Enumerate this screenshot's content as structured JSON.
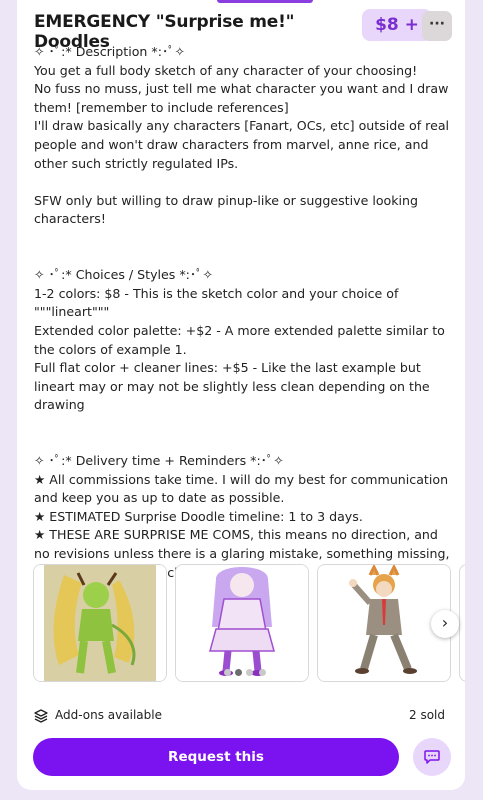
{
  "listing": {
    "title": "EMERGENCY \"Surprise me!\" Doodles",
    "price": "$8 +",
    "more_icon": "ellipsis-icon",
    "more_label": "···"
  },
  "description": {
    "text": "✧ ･ﾟ:* Description *:･ﾟ✧\nYou get a full body sketch of any character of your choosing!\nNo fuss no muss, just tell me what character you want and I draw them! [remember to include references]\nI'll draw basically any characters [Fanart, OCs, etc] outside of real people and won't draw characters from marvel, anne rice, and other such strictly regulated IPs.\n\nSFW only but willing to draw pinup-like or suggestive looking characters!\n\n\n✧ ･ﾟ:* Choices / Styles *:･ﾟ✧\n1-2 colors: $8 - This is the sketch color and your choice of \"\"\"lineart\"\"\"\nExtended color palette: +$2 - A more extended palette similar to the colors of example 1.\nFull flat color + cleaner lines: +$5 - Like the last example but lineart may or may not be slightly less clean depending on the drawing\n\n\n✧ ･ﾟ:* Delivery time + Reminders *:･ﾟ✧\n★ All commissions take time. I will do my best for communication and keep you as up to date as possible.\n★ ESTIMATED Surprise Doodle timeline: 1 to 3 days.\n★ THESE ARE SURPRISE ME COMS, this means no direction, and no revisions unless there is a glaring mistake, something missing, or similar issues in a character design."
  },
  "gallery": {
    "images": [
      "green-horned-character-image",
      "purple-haired-girl-image",
      "orange-cat-eared-boy-image"
    ],
    "next_icon": "chevron-right-icon",
    "next_label": "›",
    "active_index": 1,
    "count": 3
  },
  "footer": {
    "addons_icon": "layers-icon",
    "addons_label": "Add-ons available",
    "sold_label": "2 sold",
    "request_label": "Request this",
    "chat_icon": "chat-bubble-icon"
  }
}
